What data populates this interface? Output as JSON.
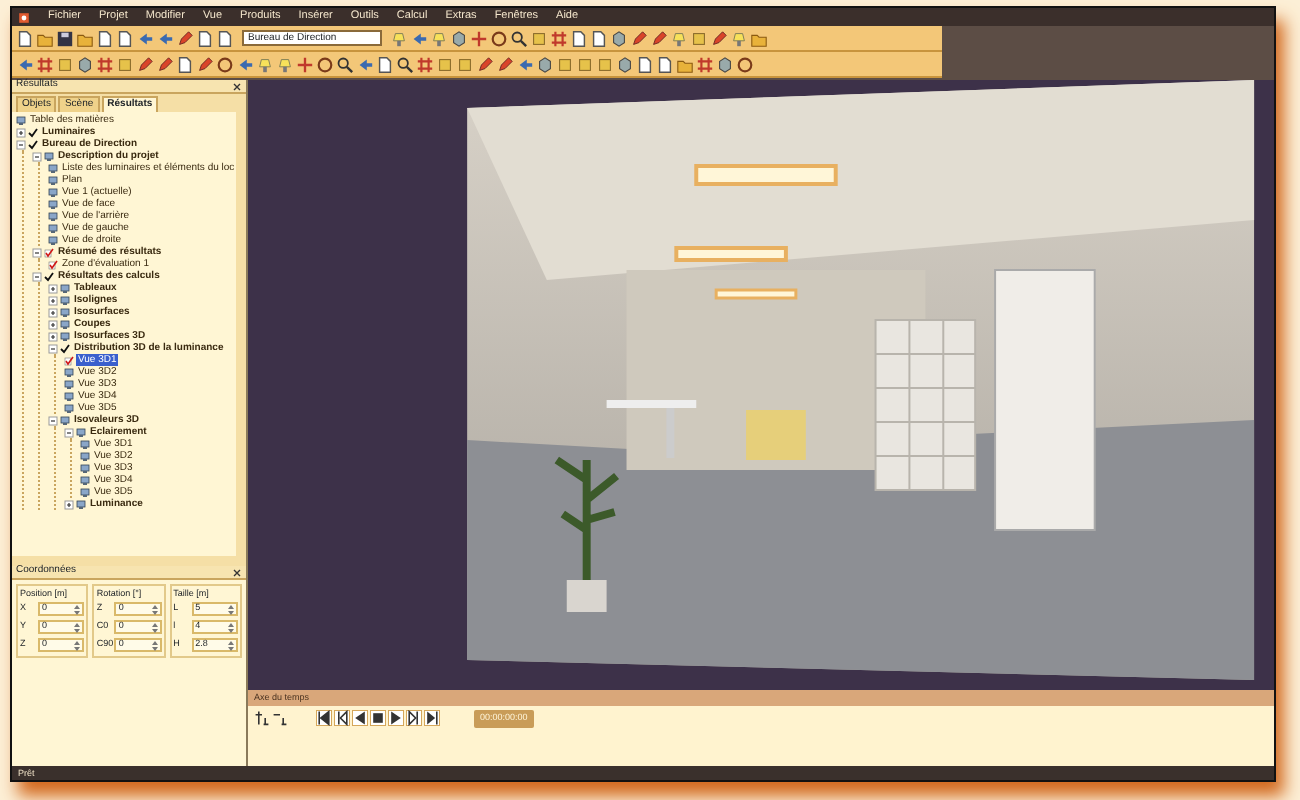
{
  "menu": [
    "Fichier",
    "Projet",
    "Modifier",
    "Vue",
    "Produits",
    "Insérer",
    "Outils",
    "Calcul",
    "Extras",
    "Fenêtres",
    "Aide"
  ],
  "toolbar": {
    "project_combo": "Bureau de Direction"
  },
  "panel": {
    "title": "Résultats",
    "tabs": [
      {
        "label": "Objets",
        "selected": false
      },
      {
        "label": "Scène",
        "selected": false
      },
      {
        "label": "Résultats",
        "selected": true
      }
    ],
    "tree": [
      {
        "label": "Table des matières",
        "kind": "page",
        "selected": false
      },
      {
        "label": "Luminaires",
        "kind": "check",
        "selected": false,
        "expanded": false
      },
      {
        "label": "Bureau de Direction",
        "kind": "check",
        "selected": false,
        "expanded": true,
        "children": [
          {
            "label": "Description du projet",
            "kind": "page",
            "selected": false,
            "expanded": true,
            "children": [
              {
                "label": "Liste des luminaires et éléments du loc",
                "kind": "page",
                "selected": false
              },
              {
                "label": "Plan",
                "kind": "page",
                "selected": false
              },
              {
                "label": "Vue 1 (actuelle)",
                "kind": "page",
                "selected": false
              },
              {
                "label": "Vue de face",
                "kind": "page",
                "selected": false
              },
              {
                "label": "Vue de l'arrière",
                "kind": "page",
                "selected": false
              },
              {
                "label": "Vue de gauche",
                "kind": "page",
                "selected": false
              },
              {
                "label": "Vue de droite",
                "kind": "page",
                "selected": false
              }
            ]
          },
          {
            "label": "Résumé des résultats",
            "kind": "redcheck",
            "selected": false,
            "expanded": true,
            "children": [
              {
                "label": "Zone d'évaluation 1",
                "kind": "redcheck",
                "selected": false
              }
            ]
          },
          {
            "label": "Résultats des calculs",
            "kind": "check",
            "selected": false,
            "expanded": true,
            "children": [
              {
                "label": "Tableaux",
                "kind": "page",
                "selected": false,
                "expanded": false
              },
              {
                "label": "Isolignes",
                "kind": "page",
                "selected": false,
                "expanded": false
              },
              {
                "label": "Isosurfaces",
                "kind": "page",
                "selected": false,
                "expanded": false
              },
              {
                "label": "Coupes",
                "kind": "page",
                "selected": false,
                "expanded": false
              },
              {
                "label": "Isosurfaces 3D",
                "kind": "page",
                "selected": false,
                "expanded": false
              },
              {
                "label": "Distribution 3D de la luminance",
                "kind": "check",
                "selected": false,
                "expanded": true,
                "children": [
                  {
                    "label": "Vue 3D1",
                    "kind": "redcheck",
                    "selected": true
                  },
                  {
                    "label": "Vue 3D2",
                    "kind": "page",
                    "selected": false
                  },
                  {
                    "label": "Vue 3D3",
                    "kind": "page",
                    "selected": false
                  },
                  {
                    "label": "Vue 3D4",
                    "kind": "page",
                    "selected": false
                  },
                  {
                    "label": "Vue 3D5",
                    "kind": "page",
                    "selected": false
                  }
                ]
              },
              {
                "label": "Isovaleurs 3D",
                "kind": "page",
                "selected": false,
                "expanded": true,
                "children": [
                  {
                    "label": "Eclairement",
                    "kind": "page",
                    "selected": false,
                    "expanded": true,
                    "children": [
                      {
                        "label": "Vue 3D1",
                        "kind": "page",
                        "selected": false
                      },
                      {
                        "label": "Vue 3D2",
                        "kind": "page",
                        "selected": false
                      },
                      {
                        "label": "Vue 3D3",
                        "kind": "page",
                        "selected": false
                      },
                      {
                        "label": "Vue 3D4",
                        "kind": "page",
                        "selected": false
                      },
                      {
                        "label": "Vue 3D5",
                        "kind": "page",
                        "selected": false
                      }
                    ]
                  },
                  {
                    "label": "Luminance",
                    "kind": "page",
                    "selected": false,
                    "expanded": false
                  }
                ]
              }
            ]
          }
        ]
      }
    ]
  },
  "coordinates": {
    "title": "Coordonnées",
    "groups": [
      {
        "title": "Position [m]",
        "fields": [
          {
            "label": "X",
            "value": "0"
          },
          {
            "label": "Y",
            "value": "0"
          },
          {
            "label": "Z",
            "value": "0"
          }
        ]
      },
      {
        "title": "Rotation [°]",
        "fields": [
          {
            "label": "Z",
            "value": "0"
          },
          {
            "label": "C0",
            "value": "0"
          },
          {
            "label": "C90",
            "value": "0"
          }
        ]
      },
      {
        "title": "Taille [m]",
        "fields": [
          {
            "label": "L",
            "value": "5"
          },
          {
            "label": "l",
            "value": "4"
          },
          {
            "label": "H",
            "value": "2.8"
          }
        ]
      }
    ]
  },
  "timeline": {
    "title": "Axe du temps",
    "time": "00:00:00:00"
  },
  "status_bar": "Prêt"
}
